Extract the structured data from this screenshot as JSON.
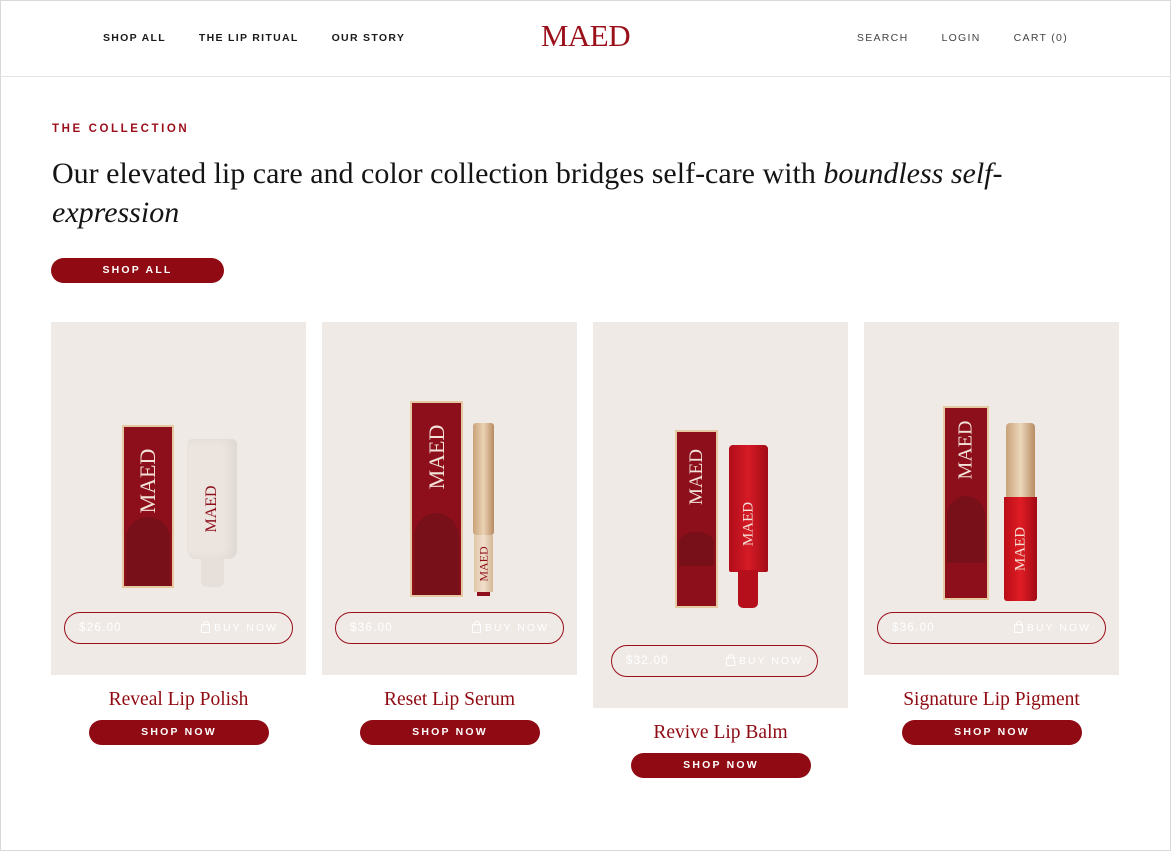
{
  "brand": {
    "logo": "MAED",
    "accent": "#9b0f1b",
    "card_bg": "#efeae6"
  },
  "nav": {
    "left": [
      "SHOP ALL",
      "THE LIP RITUAL",
      "OUR STORY"
    ],
    "right": [
      "SEARCH",
      "LOGIN",
      "CART (0)"
    ]
  },
  "intro": {
    "eyebrow": "THE COLLECTION",
    "headline_plain": "Our elevated lip care and color collection bridges self-care with ",
    "headline_italic": "boundless self-expression",
    "cta": "SHOP ALL"
  },
  "products": [
    {
      "name": "Reveal Lip Polish",
      "price": "$26.00",
      "buy_label": "BUY NOW",
      "cta": "SHOP NOW",
      "box_text": "MAED"
    },
    {
      "name": "Reset Lip Serum",
      "price": "$36.00",
      "buy_label": "BUY NOW",
      "cta": "SHOP NOW",
      "box_text": "MAED"
    },
    {
      "name": "Revive Lip Balm",
      "price": "$32.00",
      "buy_label": "BUY NOW",
      "cta": "SHOP NOW",
      "box_text": "MAED"
    },
    {
      "name": "Signature Lip Pigment",
      "price": "$36.00",
      "buy_label": "BUY NOW",
      "cta": "SHOP NOW",
      "box_text": "MAED"
    }
  ]
}
